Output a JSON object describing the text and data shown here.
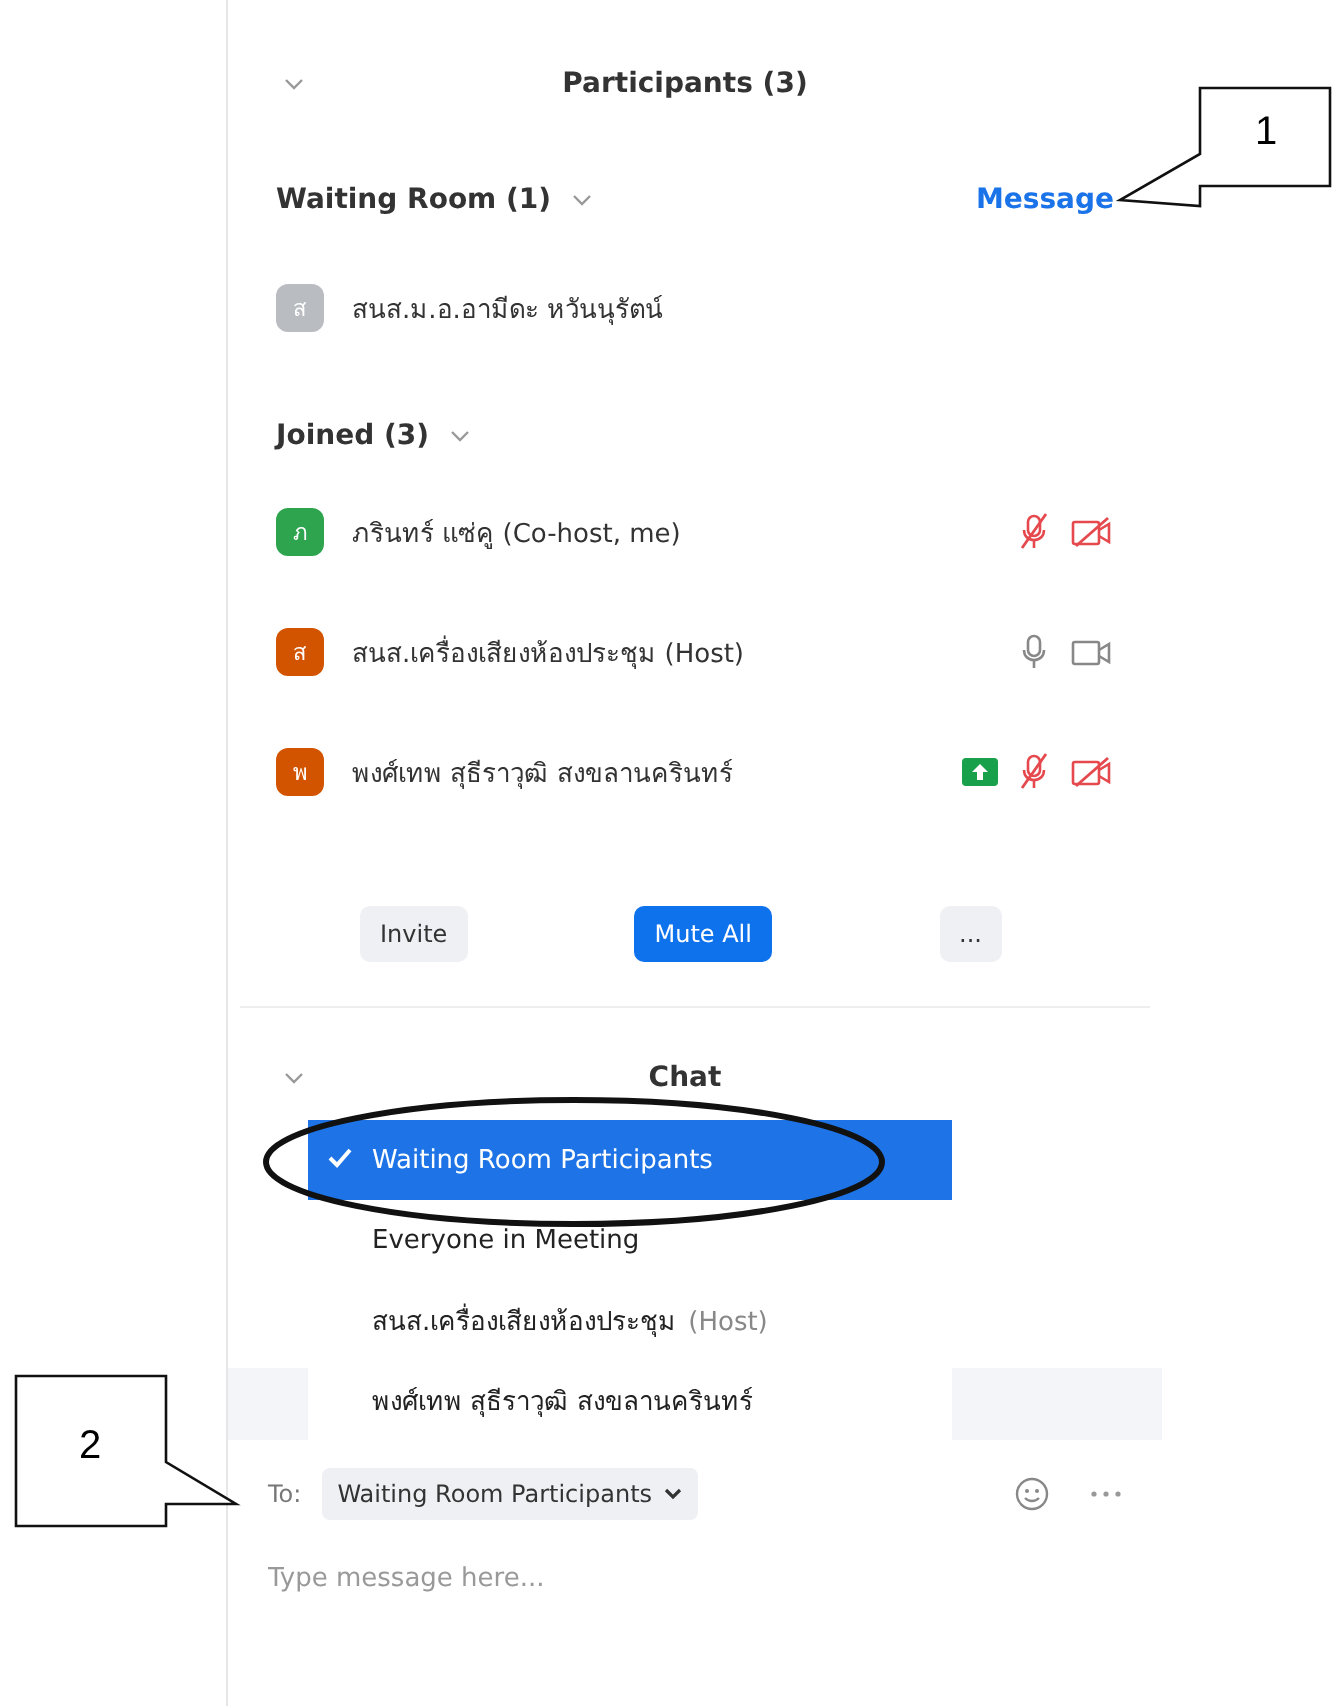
{
  "participants": {
    "title": "Participants (3)",
    "waiting_room": {
      "title": "Waiting Room (1)",
      "action": "Message",
      "people": [
        {
          "initial": "ส",
          "name": "สนส.ม.อ.อามีดะ หวันนุรัตน์",
          "color": "#b9bcc0"
        }
      ]
    },
    "joined": {
      "title": "Joined (3)",
      "people": [
        {
          "initial": "ภ",
          "name": "ภรินทร์ แซ่คู (Co-host, me)",
          "color": "#2ea44f",
          "sharing": false,
          "audio_muted": true,
          "video_muted": true
        },
        {
          "initial": "ส",
          "name": "สนส.เครื่องเสียงห้องประชุม (Host)",
          "color": "#d35400",
          "sharing": false,
          "audio_muted": false,
          "video_muted": false
        },
        {
          "initial": "พ",
          "name": "พงศ์เทพ  สุธีราวุฒิ สงขลานครินทร์",
          "color": "#d35400",
          "sharing": true,
          "audio_muted": true,
          "video_muted": true
        }
      ]
    },
    "buttons": [
      {
        "label": "Invite",
        "kind": "plain"
      },
      {
        "label": "Mute All",
        "kind": "primary"
      },
      {
        "label": "...",
        "kind": "plain"
      }
    ]
  },
  "chat": {
    "title": "Chat",
    "menu": [
      {
        "name": "Waiting Room Participants",
        "selected": true
      },
      {
        "name": "Everyone in Meeting",
        "selected": false
      },
      {
        "name": "สนส.เครื่องเสียงห้องประชุม",
        "tag": "(Host)",
        "selected": false
      },
      {
        "name": "พงศ์เทพ  สุธีราวุฒิ สงขลานครินทร์",
        "selected": false
      }
    ],
    "to_label": "To:",
    "recipient": "Waiting Room Participants",
    "placeholder": "Type message here..."
  },
  "callouts": [
    {
      "number": "1"
    },
    {
      "number": "2"
    }
  ]
}
